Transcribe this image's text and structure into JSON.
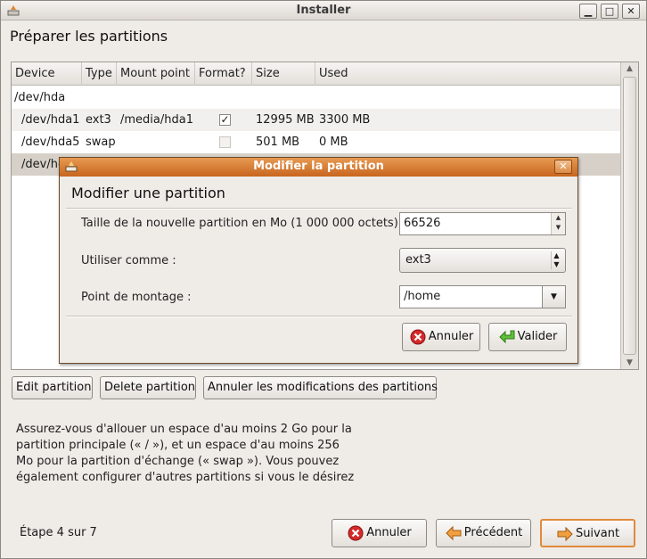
{
  "window": {
    "title": "Installer"
  },
  "page": {
    "title": "Préparer les partitions"
  },
  "table": {
    "columns": [
      "Device",
      "Type",
      "Mount point",
      "Format?",
      "Size",
      "Used"
    ],
    "rows": [
      {
        "device": "/dev/hda",
        "type": "",
        "mount": "",
        "format": null,
        "size": "",
        "used": ""
      },
      {
        "device": "/dev/hda1",
        "type": "ext3",
        "mount": "/media/hda1",
        "format": true,
        "size": "12995 MB",
        "used": "3300 MB"
      },
      {
        "device": "/dev/hda5",
        "type": "swap",
        "mount": "",
        "format": false,
        "size": "501 MB",
        "used": "0 MB"
      },
      {
        "device": "/dev/hc",
        "type": "",
        "mount": "",
        "format": null,
        "size": "",
        "used": ""
      }
    ]
  },
  "partition_buttons": {
    "edit": "Edit partition",
    "delete": "Delete partition",
    "revert": "Annuler les modifications des partitions"
  },
  "info": [
    "Assurez-vous d'allouer un espace d'au moins 2 Go pour la",
    "partition principale (« / »), et un espace d'au moins 256",
    "Mo pour la partition d'échange (« swap »). Vous pouvez",
    "également configurer d'autres partitions si vous le désirez"
  ],
  "footer": {
    "step": "Étape 4 sur 7",
    "cancel": "Annuler",
    "previous": "Précédent",
    "next": "Suivant"
  },
  "dialog": {
    "title": "Modifier la partition",
    "heading": "Modifier une partition",
    "size_label": "Taille de la nouvelle partition en Mo (1 000 000 octets)",
    "size_value": "66526",
    "use_as_label": "Utiliser comme :",
    "use_as_value": "ext3",
    "mount_label": "Point de montage :",
    "mount_value": "/home",
    "cancel": "Annuler",
    "ok": "Valider"
  },
  "colors": {
    "dialog_title": "#d97a33",
    "focus": "#e08a3a",
    "selected_row": "#d6d0c8"
  }
}
